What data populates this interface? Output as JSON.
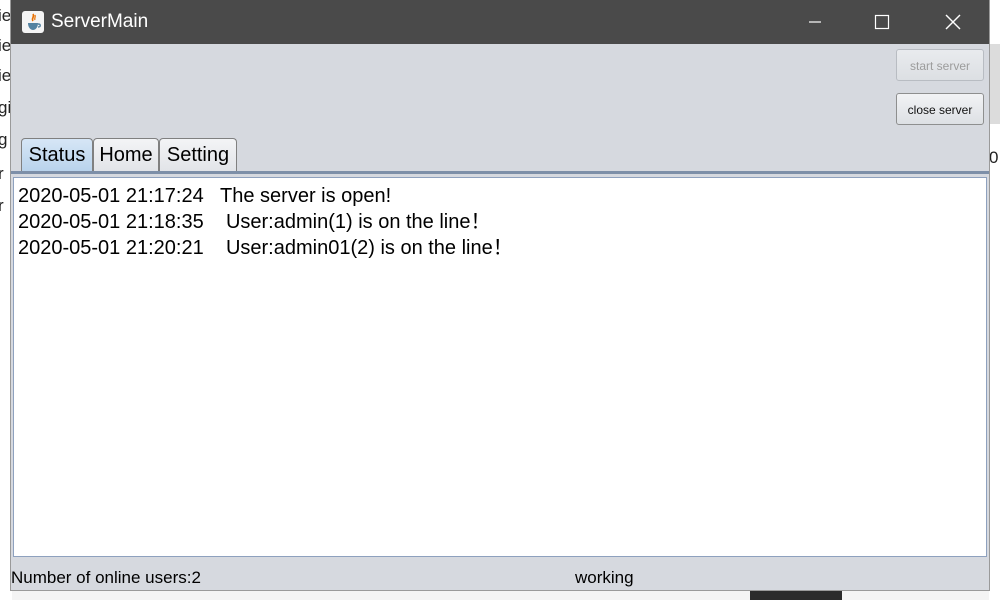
{
  "window": {
    "title": "ServerMain"
  },
  "buttons": {
    "start_server": "start server",
    "close_server": "close server"
  },
  "tabs": [
    {
      "label": "Status",
      "selected": true
    },
    {
      "label": "Home",
      "selected": false
    },
    {
      "label": "Setting",
      "selected": false
    }
  ],
  "log": [
    "2020-05-01 21:17:24   The server is open!",
    "2020-05-01 21:18:35    User:admin(1) is on the line！",
    "2020-05-01 21:20:21    User:admin01(2) is on the line！"
  ],
  "status_bar": {
    "online_users": "Number of online users:2",
    "state": "working"
  },
  "colors": {
    "titlebar": "#4a4a4a",
    "window_bg": "#d6d9df",
    "selected_tab": "#c4dbf0"
  }
}
